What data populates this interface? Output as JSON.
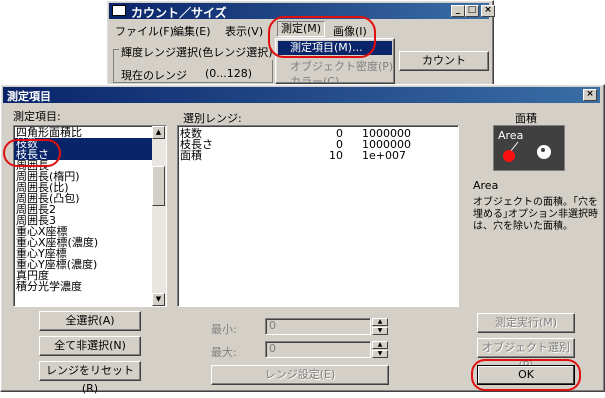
{
  "bg_window": {
    "title": "カウント／サイズ",
    "menu": [
      "ファイル(F)",
      "編集(E)",
      "表示(V)",
      "測定(M)",
      "画像(I)"
    ],
    "group_label": "輝度レンジ選択(色レンジ選択)",
    "current_range_label": "現在のレンジ",
    "current_range_value": "(0...128)",
    "count_button": "カウント",
    "dropdown": [
      "測定項目(M)...",
      "オブジェクト密度(P)",
      "カラー(C)"
    ]
  },
  "dialog": {
    "title": "測定項目",
    "measure_items_label": "測定項目:",
    "measure_items": [
      "四角形面積比",
      "枝数",
      "枝長さ",
      "周囲長",
      "周囲長(楕円)",
      "周囲長(比)",
      "周囲長(凸包)",
      "周囲長2",
      "周囲長3",
      "重心X座標",
      "重心X座標(濃度)",
      "重心Y座標",
      "重心Y座標(濃度)",
      "真円度",
      "積分光学濃度"
    ],
    "selected_items": [
      "枝数",
      "枝長さ"
    ],
    "selected_ranges_label": "選別レンジ:",
    "ranges": [
      {
        "name": "枝数",
        "min": "0",
        "max": "1000000"
      },
      {
        "name": "枝長さ",
        "min": "0",
        "max": "1000000"
      },
      {
        "name": "面積",
        "min": "10",
        "max": "1e+007"
      }
    ],
    "preview_title": "面積",
    "preview_label": "Area",
    "measure_name": "Area",
    "description": "オブジェクトの面積。｢穴を埋める｣オプション非選択時は、穴を除いた面積。",
    "select_all": "全選択(A)",
    "deselect_all": "全て非選択(N)",
    "reset_range": "レンジをリセット(R)",
    "min_label": "最小:",
    "max_label": "最大:",
    "min_value": "0",
    "max_value": "0",
    "range_setting": "レンジ設定(E)",
    "run_measure": "測定実行(M)",
    "object_select": "オブジェクト選別(P)",
    "ok": "OK"
  },
  "colors": {
    "titlebar": "#0a246a",
    "highlight": "#0a246a",
    "annotation": "#e01010"
  }
}
